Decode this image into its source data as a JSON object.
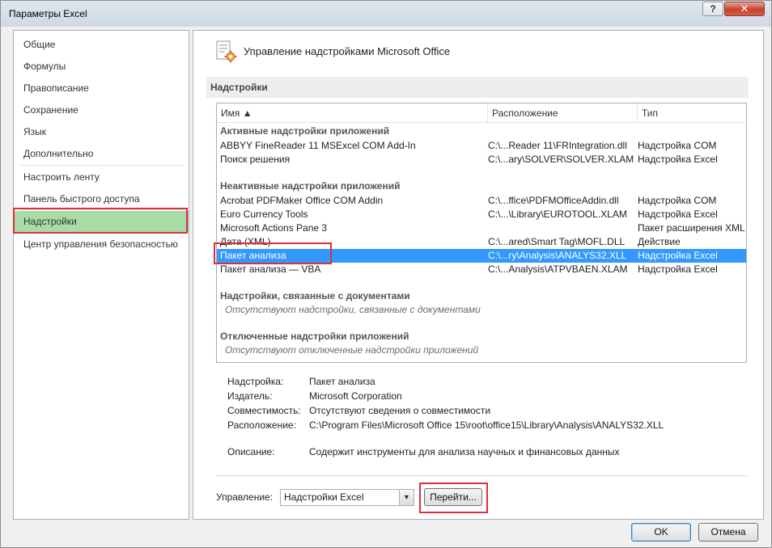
{
  "window": {
    "title": "Параметры Excel",
    "help_label": "?",
    "close_label": "✕"
  },
  "nav": {
    "items": [
      {
        "label": "Общие"
      },
      {
        "label": "Формулы"
      },
      {
        "label": "Правописание"
      },
      {
        "label": "Сохранение"
      },
      {
        "label": "Язык"
      },
      {
        "label": "Дополнительно"
      },
      {
        "label": "Настроить ленту"
      },
      {
        "label": "Панель быстрого доступа"
      },
      {
        "label": "Надстройки",
        "selected": true
      },
      {
        "label": "Центр управления безопасностью"
      }
    ]
  },
  "main": {
    "header": "Управление надстройками Microsoft Office",
    "section": "Надстройки",
    "columns": {
      "name": "Имя ▲",
      "location": "Расположение",
      "type": "Тип"
    },
    "groups": {
      "active": "Активные надстройки приложений",
      "inactive": "Неактивные надстройки приложений",
      "document": "Надстройки, связанные с документами",
      "document_empty": "Отсутствуют надстройки, связанные с документами",
      "disabled": "Отключенные надстройки приложений",
      "disabled_empty": "Отсутствуют отключенные надстройки приложений"
    },
    "active_rows": [
      {
        "name": "ABBYY FineReader 11 MSExcel COM Add-In",
        "location": "C:\\...Reader 11\\FRIntegration.dll",
        "type": "Надстройка COM"
      },
      {
        "name": "Поиск решения",
        "location": "C:\\...ary\\SOLVER\\SOLVER.XLAM",
        "type": "Надстройка Excel"
      }
    ],
    "inactive_rows": [
      {
        "name": "Acrobat PDFMaker Office COM Addin",
        "location": "C:\\...ffice\\PDFMOfficeAddin.dll",
        "type": "Надстройка COM"
      },
      {
        "name": "Euro Currency Tools",
        "location": "C:\\...\\Library\\EUROTOOL.XLAM",
        "type": "Надстройка Excel"
      },
      {
        "name": "Microsoft Actions Pane 3",
        "location": "",
        "type": "Пакет расширения XML"
      },
      {
        "name": "Дата (XML)",
        "location": "C:\\...ared\\Smart Tag\\MOFL.DLL",
        "type": "Действие"
      },
      {
        "name": "Пакет анализа",
        "location": "C:\\...ry\\Analysis\\ANALYS32.XLL",
        "type": "Надстройка Excel",
        "selected": true
      },
      {
        "name": "Пакет анализа — VBA",
        "location": "C:\\...Analysis\\ATPVBAEN.XLAM",
        "type": "Надстройка Excel"
      }
    ],
    "details": {
      "addin_label": "Надстройка:",
      "addin_value": "Пакет анализа",
      "publisher_label": "Издатель:",
      "publisher_value": "Microsoft Corporation",
      "compat_label": "Совместимость:",
      "compat_value": "Отсутствуют сведения о совместимости",
      "location_label": "Расположение:",
      "location_value": "C:\\Program Files\\Microsoft Office 15\\root\\office15\\Library\\Analysis\\ANALYS32.XLL",
      "desc_label": "Описание:",
      "desc_value": "Содержит инструменты для анализа научных и финансовых данных"
    },
    "manage": {
      "label": "Управление:",
      "selected": "Надстройки Excel",
      "go_label": "Перейти..."
    }
  },
  "buttons": {
    "ok": "OK",
    "cancel": "Отмена"
  },
  "colors": {
    "selection": "#3399ff",
    "nav_selected": "#a9dca6",
    "highlight_box": "#d9303a"
  }
}
